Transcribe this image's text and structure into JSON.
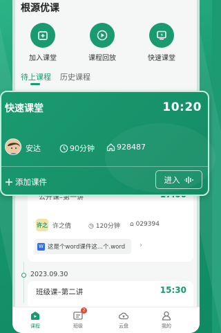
{
  "section": {
    "title": "根源优课"
  },
  "quick_actions": [
    {
      "label": "加入课堂",
      "icon": "join-class-icon"
    },
    {
      "label": "课程回放",
      "icon": "playback-icon"
    },
    {
      "label": "快速课堂",
      "icon": "quick-class-icon"
    }
  ],
  "tabs": {
    "active": "待上课程",
    "inactive": "历史课程"
  },
  "popup": {
    "title": "快速课堂",
    "time": "10:20",
    "teacher": "安达",
    "duration": "90分钟",
    "code": "928487",
    "add_label": "添加课件",
    "enter_label": "进入"
  },
  "lesson": {
    "title_partial": "公开课–第一讲",
    "time_partial": "17:00",
    "teacher_avatar_text": "许之",
    "teacher": "许之倩",
    "duration": "120分钟",
    "code": "029394",
    "attachment": "这是个word课件这...个.word"
  },
  "date_label": "2023.09.30",
  "lesson2": {
    "title": "班级课–第二讲",
    "time": "15:30"
  },
  "nav": {
    "items": [
      {
        "label": "课程",
        "active": true
      },
      {
        "label": "班级",
        "badge": "2"
      },
      {
        "label": "云盘"
      },
      {
        "label": "我的"
      }
    ]
  },
  "colors": {
    "accent": "#1a9a70",
    "badge": "#e4483b"
  }
}
